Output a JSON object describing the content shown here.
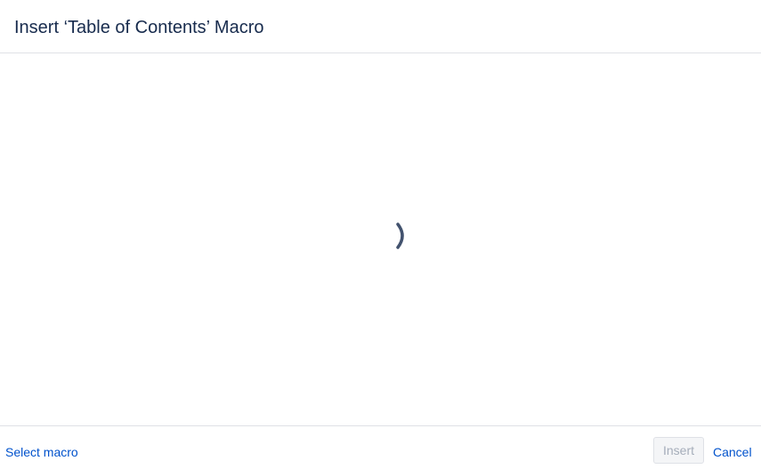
{
  "dialog": {
    "title": "Insert ‘Table of Contents’ Macro"
  },
  "body": {
    "loading": true,
    "spinner_icon": "loading-spinner-icon",
    "spinner_color": "#42526e"
  },
  "footer": {
    "select_macro_label": "Select macro",
    "insert_label": "Insert",
    "insert_disabled": true,
    "cancel_label": "Cancel"
  },
  "colors": {
    "title_text": "#172b4d",
    "link": "#0052cc",
    "divider": "#dfe1e6",
    "disabled_button_bg": "#f4f5f7",
    "disabled_button_text": "#a5adba"
  }
}
